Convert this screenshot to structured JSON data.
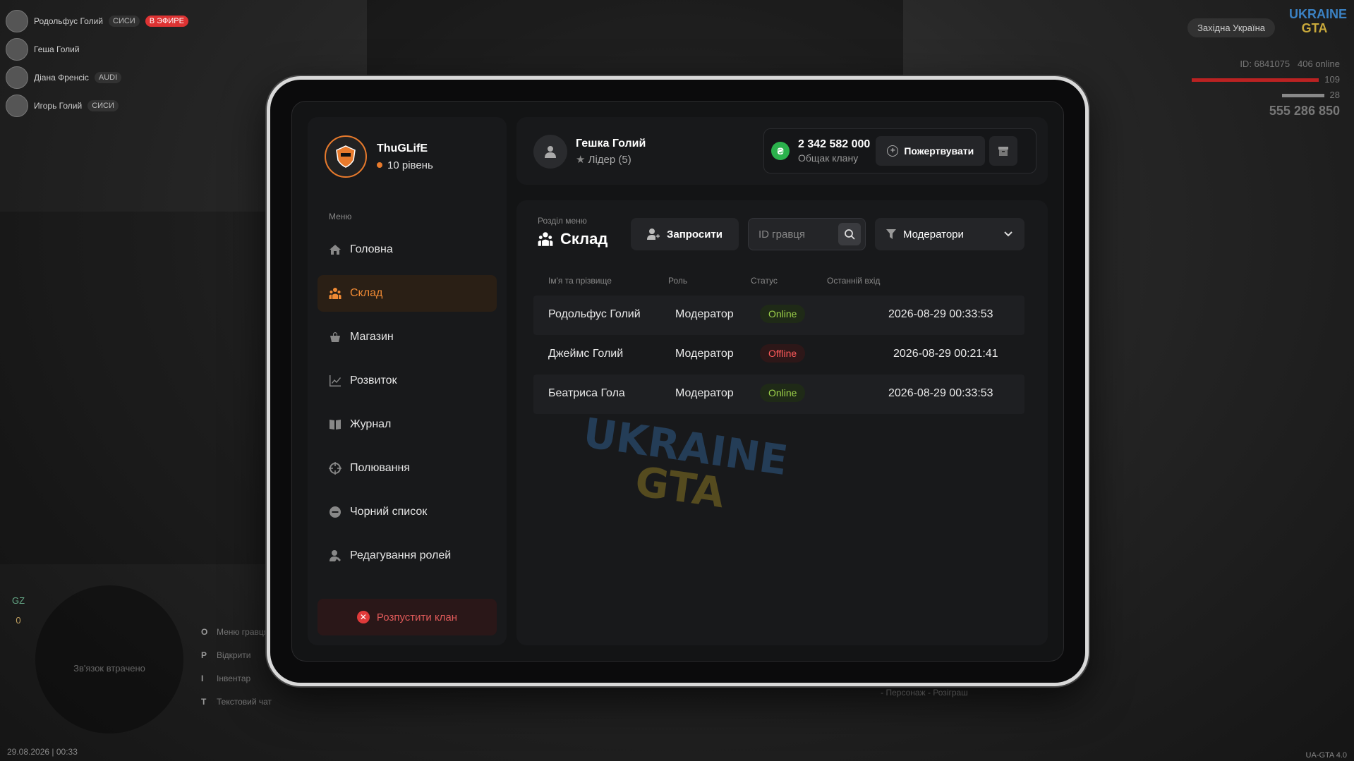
{
  "hud": {
    "players": [
      {
        "name": "Родольфус Голий",
        "tag": "СИСИ",
        "live": "В ЭФИРЕ"
      },
      {
        "name": "Геша Голий",
        "tag": "",
        "live": ""
      },
      {
        "name": "Діана Френсіс",
        "tag": "AUDI",
        "live": ""
      },
      {
        "name": "Игорь Голий",
        "tag": "СИСИ",
        "live": ""
      }
    ],
    "region": "Західна Україна",
    "logo_line1": "UKRAINE",
    "logo_line2": "GTA",
    "player_id": "ID: 6841075",
    "online": "406 online",
    "health": "109",
    "armor": "28",
    "money": "555 286 850",
    "gz_label": "GZ",
    "gz_value": "0",
    "minimap_text": "Зв'язок втрачено",
    "keys": [
      {
        "key": "O",
        "label": "Меню гравця"
      },
      {
        "key": "P",
        "label": "Відкрити"
      },
      {
        "key": "I",
        "label": "Інвентар"
      },
      {
        "key": "T",
        "label": "Текстовий чат"
      }
    ],
    "banner_text": "- Персонаж - Розіграш",
    "datetime": "29.08.2026 | 00:33",
    "version": "UA-GTA 4.0"
  },
  "clan": {
    "name": "ThuGLifE",
    "level": "10 рівень"
  },
  "menu": {
    "caption": "Меню",
    "items": [
      {
        "label": "Головна",
        "icon": "home-icon",
        "active": false
      },
      {
        "label": "Склад",
        "icon": "members-icon",
        "active": true
      },
      {
        "label": "Магазин",
        "icon": "shop-icon",
        "active": false
      },
      {
        "label": "Розвиток",
        "icon": "chart-icon",
        "active": false
      },
      {
        "label": "Журнал",
        "icon": "book-icon",
        "active": false
      },
      {
        "label": "Полювання",
        "icon": "crosshair-icon",
        "active": false
      },
      {
        "label": "Чорний список",
        "icon": "block-icon",
        "active": false
      },
      {
        "label": "Редагування ролей",
        "icon": "role-icon",
        "active": false
      }
    ],
    "disband_label": "Розпустити клан"
  },
  "header": {
    "user_name": "Гешка Голий",
    "user_role": "Лідер (5)",
    "bank_amount": "2 342 582 000",
    "bank_label": "Общак клану",
    "donate_label": "Пожертвувати"
  },
  "section": {
    "caption": "Розділ меню",
    "title": "Склад",
    "invite_label": "Запросити",
    "search_placeholder": "ID гравця",
    "filter_value": "Модератори"
  },
  "table": {
    "columns": [
      "Ім'я та прізвище",
      "Роль",
      "Статус",
      "Останній вхід"
    ],
    "rows": [
      {
        "name": "Родольфус Голий",
        "role": "Модератор",
        "status": "Online",
        "last": "2026-08-29 00:33:53"
      },
      {
        "name": "Джеймс Голий",
        "role": "Модератор",
        "status": "Offline",
        "last": "2026-08-29 00:21:41"
      },
      {
        "name": "Беатриса Гола",
        "role": "Модератор",
        "status": "Online",
        "last": "2026-08-29 00:33:53"
      }
    ]
  },
  "colors": {
    "accent": "#f08a34",
    "online": "#9dd14a",
    "offline": "#ff5a5a",
    "money": "#2bb24c"
  }
}
